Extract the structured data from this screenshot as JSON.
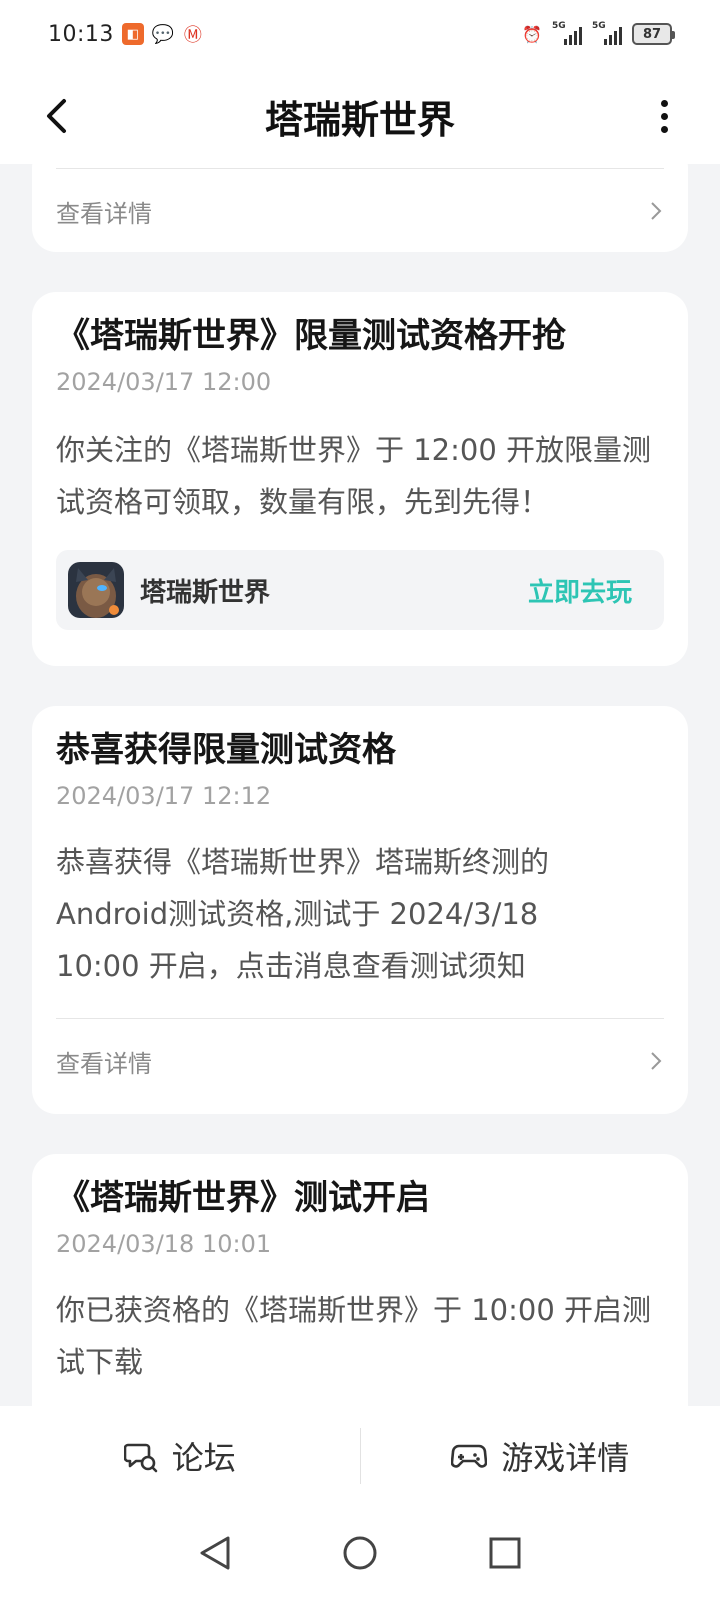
{
  "status_bar": {
    "time": "10:13",
    "net1": "5G",
    "net2": "5G",
    "battery": "87"
  },
  "header": {
    "title": "塔瑞斯世界"
  },
  "cards": [
    {
      "detail_label": "查看详情"
    },
    {
      "title": "《塔瑞斯世界》限量测试资格开抢",
      "time": "2024/03/17 12:00",
      "body": "你关注的《塔瑞斯世界》于 12:00 开放限量测试资格可领取，数量有限，先到先得！",
      "game_name": "塔瑞斯世界",
      "play_label": "立即去玩"
    },
    {
      "title": "恭喜获得限量测试资格",
      "time": "2024/03/17 12:12",
      "body": "恭喜获得《塔瑞斯世界》塔瑞斯终测的Android测试资格,测试于 2024/3/18 10:00 开启，点击消息查看测试须知",
      "detail_label": "查看详情"
    },
    {
      "title": "《塔瑞斯世界》测试开启",
      "time": "2024/03/18 10:01",
      "body": "你已获资格的《塔瑞斯世界》于 10:00 开启测试下载"
    }
  ],
  "bottom_tabs": [
    {
      "label": "论坛",
      "icon": "forum-icon"
    },
    {
      "label": "游戏详情",
      "icon": "gamepad-icon"
    }
  ],
  "colors": {
    "accent": "#2dc5b4",
    "background": "#f3f4f6",
    "card": "#ffffff"
  }
}
